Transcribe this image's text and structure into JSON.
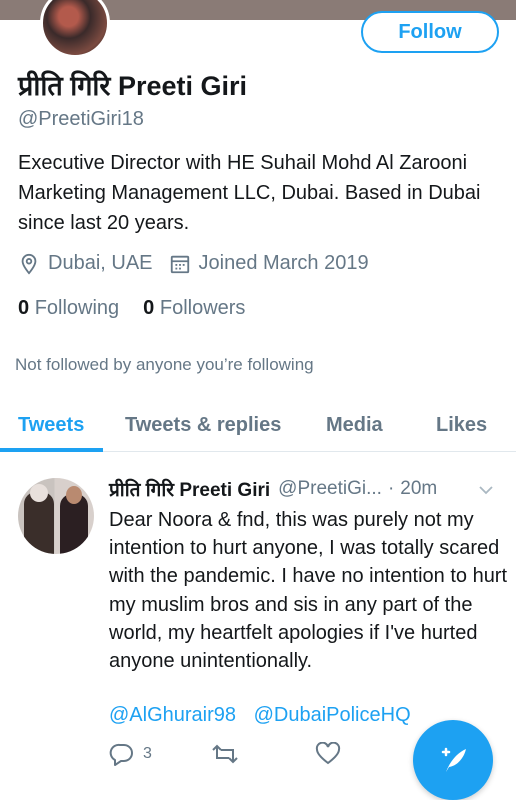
{
  "profile": {
    "name": "प्रीति गिरि Preeti Giri",
    "handle": "@PreetiGiri18",
    "bio": "Executive Director with HE Suhail Mohd  Al Zarooni Marketing  Management LLC, Dubai. Based in Dubai since last 20 years.",
    "location": "Dubai, UAE",
    "joined": "Joined March 2019",
    "following_count": "0",
    "following_label": "Following",
    "followers_count": "0",
    "followers_label": "Followers",
    "not_followed_text": "Not followed by anyone you’re following",
    "follow_button": "Follow"
  },
  "tabs": [
    {
      "label": "Tweets",
      "active": true
    },
    {
      "label": "Tweets & replies",
      "active": false
    },
    {
      "label": "Media",
      "active": false
    },
    {
      "label": "Likes",
      "active": false
    }
  ],
  "tweet": {
    "name": "प्रीति गिरि Preeti Giri",
    "handle": "@PreetiGi...",
    "separator": "·",
    "time": "20m",
    "text": "Dear Noora & fnd, this was purely not my intention to hurt anyone, I was totally scared with the pandemic. I have no intention to hurt my muslim bros and sis in any part of the world, my heartfelt apologies if I've hurted anyone unintentionally.",
    "mentions": [
      "@AlGhurair98",
      "@DubaiPoliceHQ"
    ],
    "reply_count": "3"
  },
  "icons": {
    "location": "location-pin-icon",
    "calendar": "calendar-icon",
    "reply": "reply-icon",
    "retweet": "retweet-icon",
    "like": "heart-icon",
    "compose": "compose-tweet-icon",
    "more": "chevron-down-icon"
  },
  "colors": {
    "accent": "#1da1f2",
    "secondary_text": "#657786",
    "primary_text": "#14171a"
  }
}
